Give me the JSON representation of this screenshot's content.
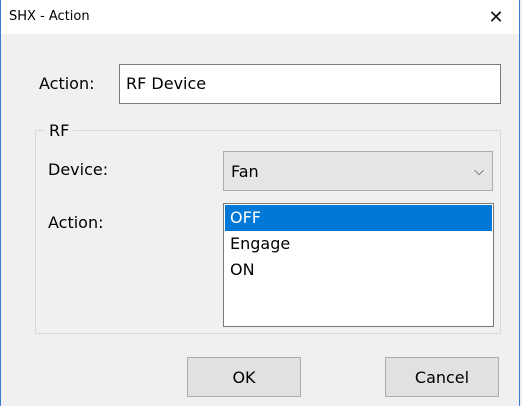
{
  "window": {
    "title": "SHX - Action",
    "close_glyph": "✕"
  },
  "action_field": {
    "label": "Action:",
    "value": "RF Device"
  },
  "rf_group": {
    "legend": "RF",
    "device_label": "Device:",
    "device_value": "Fan",
    "dropdown_glyph": "⌵",
    "action_label": "Action:",
    "action_options": [
      "OFF",
      "Engage",
      "ON"
    ],
    "selected_option": "OFF"
  },
  "buttons": {
    "ok_label": "OK",
    "cancel_label": "Cancel"
  },
  "colors": {
    "selection": "#0078d7",
    "window_border": "#3c78d8"
  }
}
